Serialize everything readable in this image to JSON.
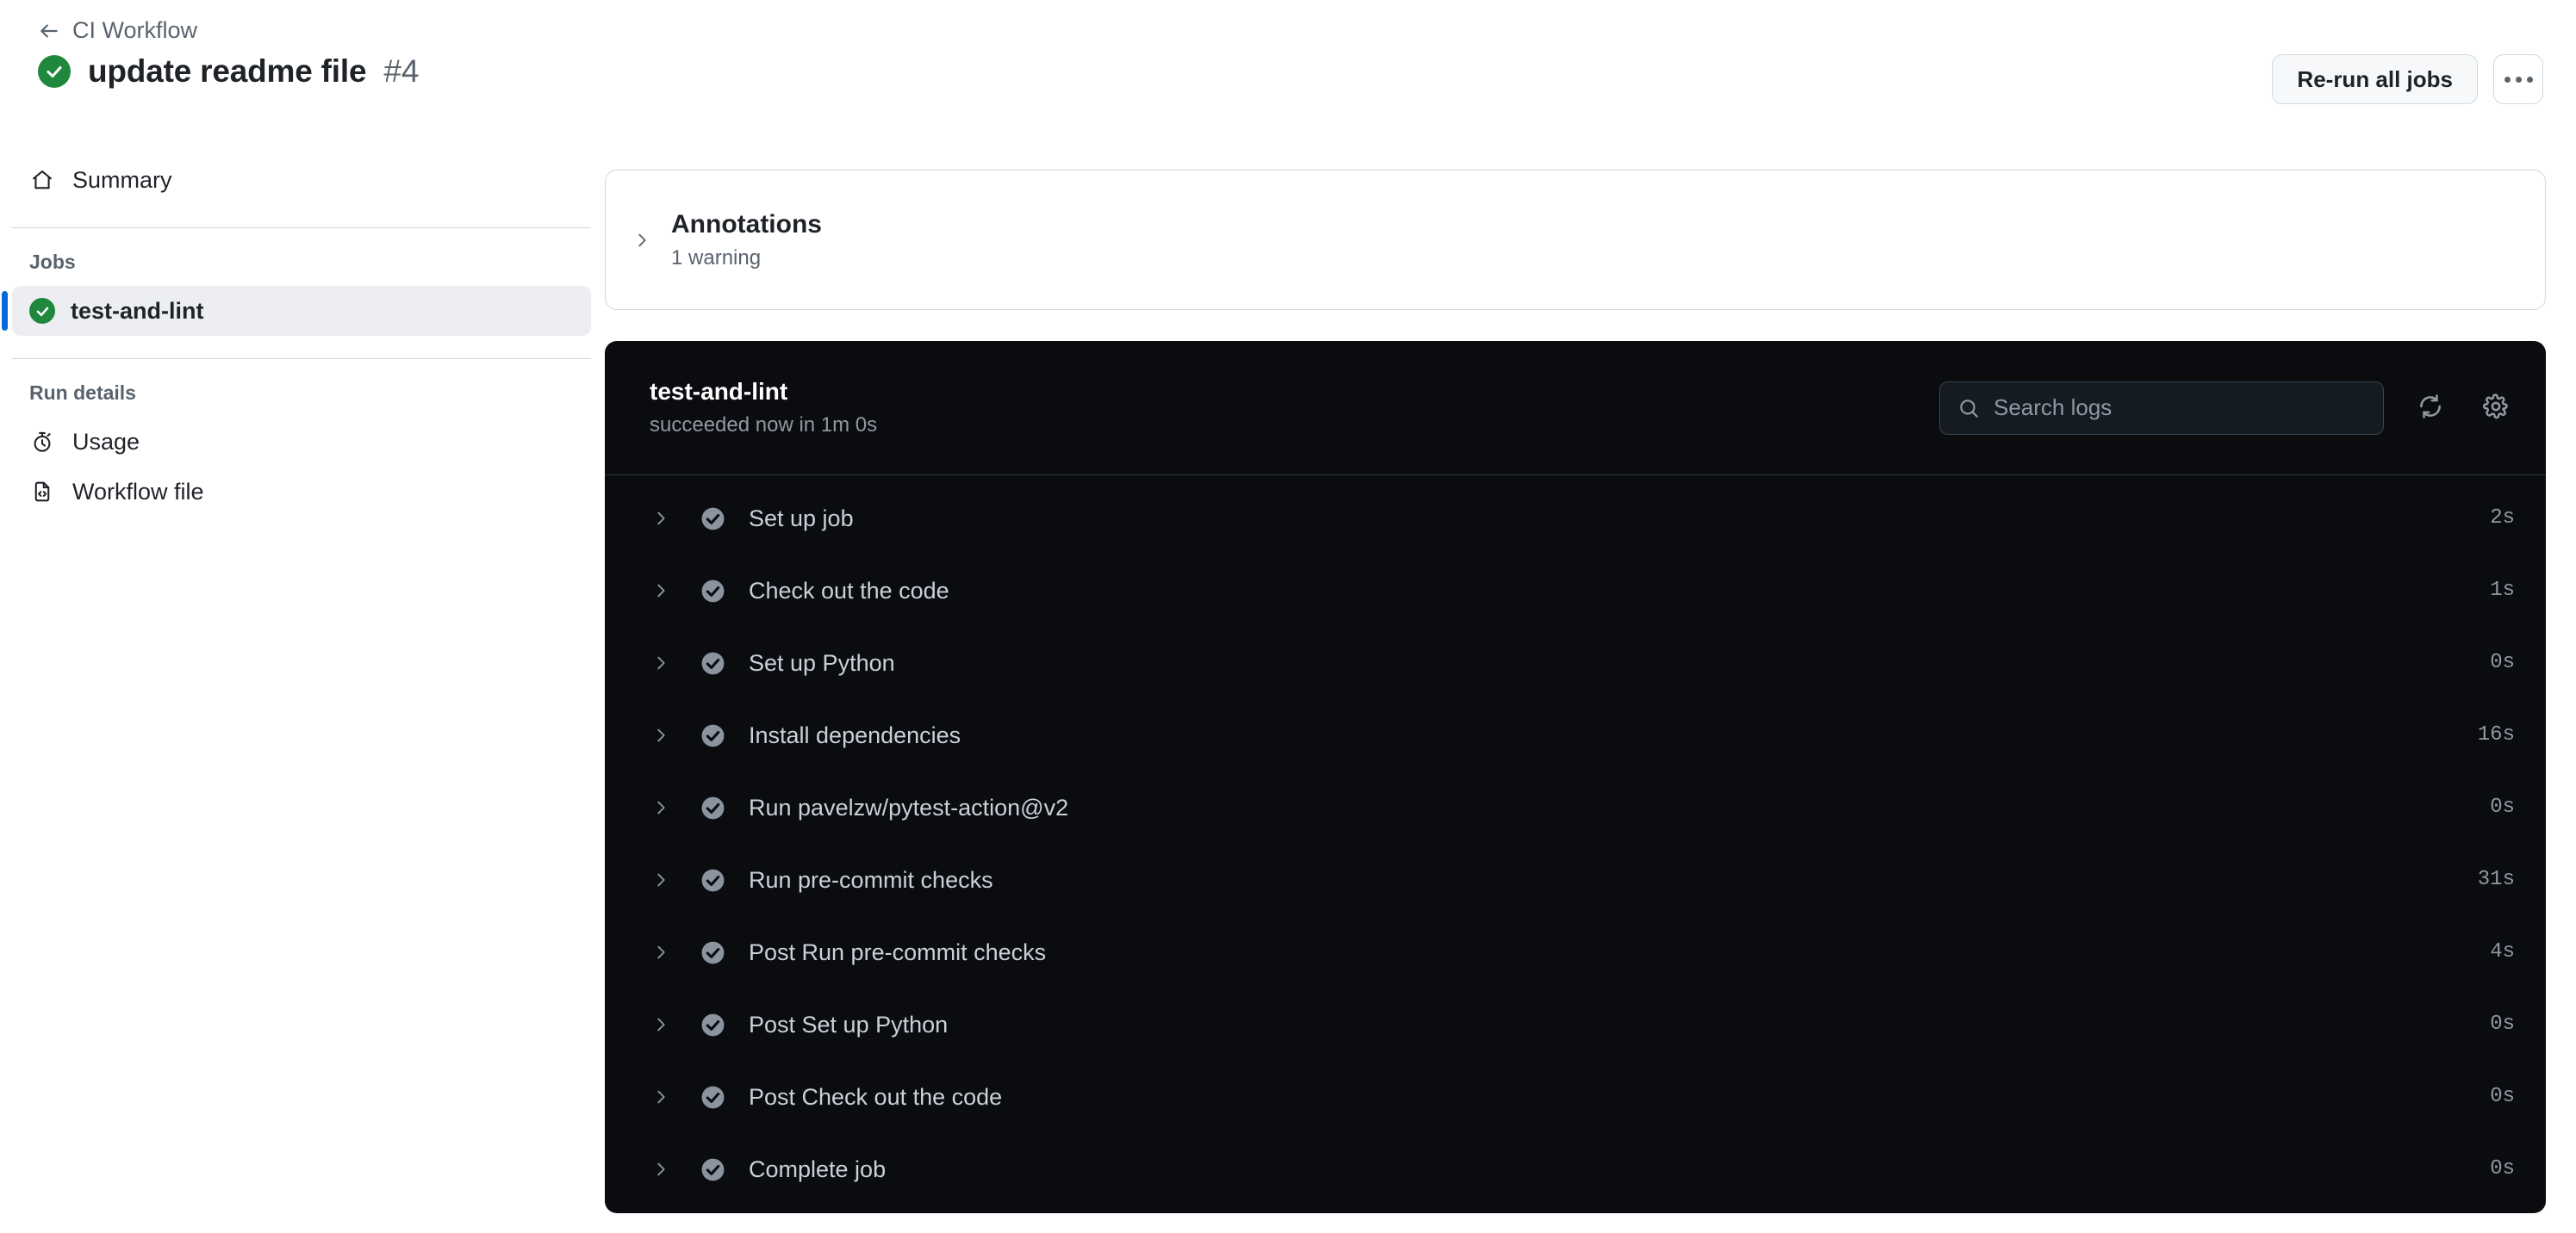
{
  "header": {
    "breadcrumb_label": "CI Workflow",
    "run_title": "update readme file",
    "run_number": "#4",
    "run_status_icon": "check-circle-success-icon",
    "back_icon": "arrow-left-icon",
    "rerun_button_label": "Re-run all jobs",
    "overflow_button_icon": "kebab-horizontal-icon"
  },
  "sidebar": {
    "summary": {
      "label": "Summary",
      "icon": "home-icon"
    },
    "jobs_section_label": "Jobs",
    "jobs": [
      {
        "label": "test-and-lint",
        "status_icon": "check-circle-success-icon",
        "selected": true
      }
    ],
    "run_details_section_label": "Run details",
    "run_details": [
      {
        "label": "Usage",
        "icon": "stopwatch-icon"
      },
      {
        "label": "Workflow file",
        "icon": "file-code-icon"
      }
    ]
  },
  "annotations": {
    "title": "Annotations",
    "summary": "1 warning",
    "expand_icon": "chevron-right-icon",
    "expanded": false
  },
  "log_panel": {
    "job_name": "test-and-lint",
    "job_status": "succeeded now in 1m 0s",
    "search": {
      "placeholder": "Search logs",
      "value": "",
      "icon": "search-icon"
    },
    "refresh_icon": "sync-icon",
    "settings_icon": "gear-icon",
    "steps": [
      {
        "name": "Set up job",
        "duration": "2s",
        "status_icon": "check-circle-muted-icon",
        "expand_icon": "chevron-right-icon"
      },
      {
        "name": "Check out the code",
        "duration": "1s",
        "status_icon": "check-circle-muted-icon",
        "expand_icon": "chevron-right-icon"
      },
      {
        "name": "Set up Python",
        "duration": "0s",
        "status_icon": "check-circle-muted-icon",
        "expand_icon": "chevron-right-icon"
      },
      {
        "name": "Install dependencies",
        "duration": "16s",
        "status_icon": "check-circle-muted-icon",
        "expand_icon": "chevron-right-icon"
      },
      {
        "name": "Run pavelzw/pytest-action@v2",
        "duration": "0s",
        "status_icon": "check-circle-muted-icon",
        "expand_icon": "chevron-right-icon"
      },
      {
        "name": "Run pre-commit checks",
        "duration": "31s",
        "status_icon": "check-circle-muted-icon",
        "expand_icon": "chevron-right-icon"
      },
      {
        "name": "Post Run pre-commit checks",
        "duration": "4s",
        "status_icon": "check-circle-muted-icon",
        "expand_icon": "chevron-right-icon"
      },
      {
        "name": "Post Set up Python",
        "duration": "0s",
        "status_icon": "check-circle-muted-icon",
        "expand_icon": "chevron-right-icon"
      },
      {
        "name": "Post Check out the code",
        "duration": "0s",
        "status_icon": "check-circle-muted-icon",
        "expand_icon": "chevron-right-icon"
      },
      {
        "name": "Complete job",
        "duration": "0s",
        "status_icon": "check-circle-muted-icon",
        "expand_icon": "chevron-right-icon"
      }
    ]
  },
  "colors": {
    "success_green": "#1f883d",
    "accent_blue": "#0969da",
    "log_background": "#0a0c10",
    "muted_text": "#59636e",
    "log_muted_text": "#9198a1"
  }
}
